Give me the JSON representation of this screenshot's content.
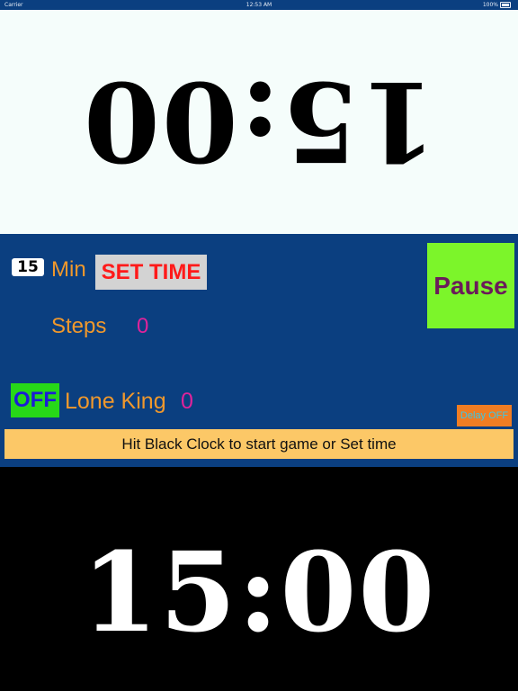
{
  "status_bar": {
    "carrier": "Carrier",
    "time": "12:53 AM",
    "battery": "100%"
  },
  "top_clock": {
    "time": "15:00",
    "background": "#f5fdfb",
    "text_color": "#000000",
    "orientation": "upside-down"
  },
  "controls": {
    "minutes_value": "15",
    "minutes_label": "Min",
    "set_time_label": "SET TIME",
    "steps_label": "Steps",
    "steps_value": "0",
    "pause_label": "Pause",
    "lone_king_toggle": "OFF",
    "lone_king_label": "Lone King",
    "lone_king_value": "0",
    "delay_label": "Delay OFF",
    "message": "Hit Black Clock to start game or Set time"
  },
  "bottom_clock": {
    "time": "15:00",
    "background": "#000000",
    "text_color": "#ffffff"
  },
  "colors": {
    "panel_background": "#0b3f80",
    "label_orange": "#f0982c",
    "value_magenta": "#e0239a",
    "pause_green": "#7cf52a",
    "toggle_green": "#27d818",
    "set_time_red": "#ff1a1a",
    "delay_orange": "#f07d23",
    "message_yellow": "#fcc867"
  }
}
